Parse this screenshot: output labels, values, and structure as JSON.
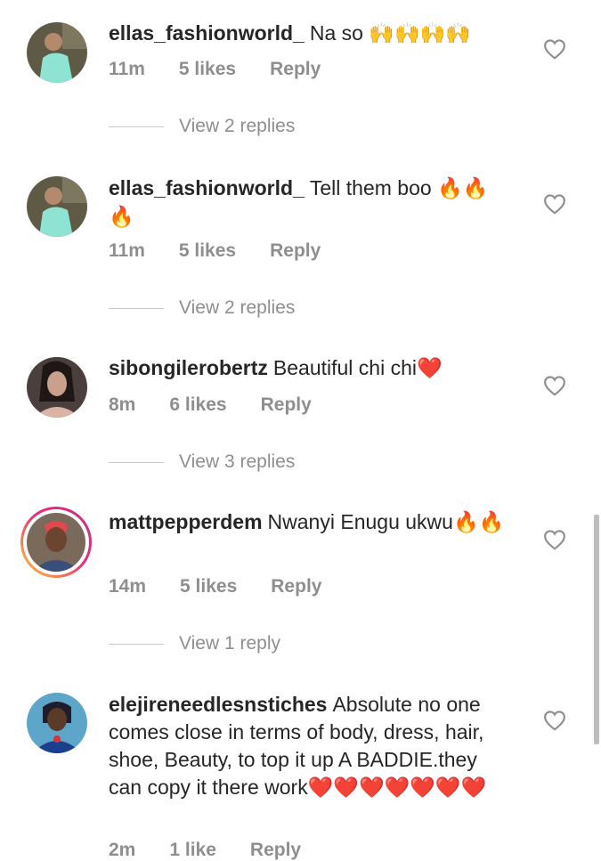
{
  "comments": [
    {
      "username": "ellas_fashionworld_",
      "text": "Na so",
      "emoji": "🙌🙌🙌🙌",
      "time": "11m",
      "likes": "5 likes",
      "reply": "Reply",
      "view_replies": "View 2 replies"
    },
    {
      "username": "ellas_fashionworld_",
      "text": "Tell them boo",
      "emoji": "🔥🔥🔥",
      "time": "11m",
      "likes": "5 likes",
      "reply": "Reply",
      "view_replies": "View 2 replies"
    },
    {
      "username": "sibongilerobertz",
      "text": "Beautiful chi chi",
      "emoji": "❤️",
      "time": "8m",
      "likes": "6 likes",
      "reply": "Reply",
      "view_replies": "View 3 replies"
    },
    {
      "username": "mattpepperdem",
      "text": "Nwanyi Enugu ukwu",
      "emoji": "🔥🔥",
      "time": "14m",
      "likes": "5 likes",
      "reply": "Reply",
      "view_replies": "View 1 reply"
    },
    {
      "username": "elejireneedlesnstiches",
      "text": "Absolute no one comes close in terms of body, dress, hair, shoe, Beauty, to top it up A BADDIE.they can copy it there work",
      "emoji": "❤️❤️❤️❤️❤️❤️❤️",
      "time": "2m",
      "likes": "1 like",
      "reply": "Reply"
    }
  ],
  "icons": {
    "like": "heart-outline-icon"
  },
  "colors": {
    "text": "#262626",
    "muted": "#8e8e8e",
    "fire": "#f4900c",
    "heart": "#e0245e"
  }
}
